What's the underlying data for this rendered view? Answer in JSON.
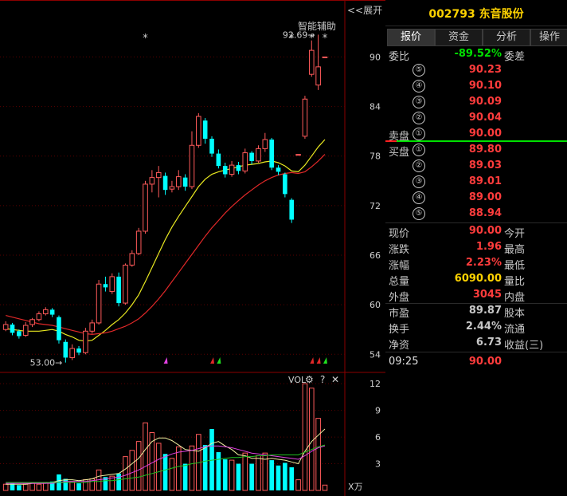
{
  "header": {
    "collapse_label": "<<展开",
    "aux_label": "智能辅助",
    "stock_title": "002793  东音股份"
  },
  "tabs": [
    {
      "label": "报价"
    },
    {
      "label": "资金"
    },
    {
      "label": "分析"
    },
    {
      "label": "操作"
    }
  ],
  "quote": {
    "weibi_label": "委比",
    "weibi_value": "-89.52%",
    "weicha_label": "委差",
    "sell_label": "卖盘",
    "buy_label": "买盘",
    "sell": [
      {
        "level": "⑤",
        "price": "90.23"
      },
      {
        "level": "④",
        "price": "90.10"
      },
      {
        "level": "③",
        "price": "90.09"
      },
      {
        "level": "②",
        "price": "90.04"
      },
      {
        "level": "①",
        "price": "90.00"
      }
    ],
    "buy": [
      {
        "level": "①",
        "price": "89.80"
      },
      {
        "level": "②",
        "price": "89.03"
      },
      {
        "level": "③",
        "price": "89.01"
      },
      {
        "level": "④",
        "price": "89.00"
      },
      {
        "level": "⑤",
        "price": "88.94"
      }
    ],
    "stats": [
      {
        "label": "现价",
        "value": "90.00",
        "label2": "今开",
        "color": "#ff3c3c"
      },
      {
        "label": "涨跌",
        "value": "1.96",
        "label2": "最高",
        "color": "#ff3c3c"
      },
      {
        "label": "涨幅",
        "value": "2.23%",
        "label2": "最低",
        "color": "#ff3c3c"
      },
      {
        "label": "总量",
        "value": "6090.00",
        "label2": "量比",
        "color": "#ffd300"
      },
      {
        "label": "外盘",
        "value": "3045",
        "label2": "内盘",
        "color": "#ff3c3c"
      },
      {
        "label": "市盈",
        "value": "89.87",
        "label2": "股本",
        "color": "#c8c8c8"
      },
      {
        "label": "换手",
        "value": "2.44%",
        "label2": "流通",
        "color": "#c8c8c8"
      },
      {
        "label": "净资",
        "value": "6.73",
        "label2": "收益(三)",
        "color": "#c8c8c8"
      }
    ],
    "tick_time": "09:25",
    "tick_price": "90.00"
  },
  "chart_data": {
    "type": "candlestick",
    "price_axis": {
      "ticks": [
        "90",
        "84",
        "78",
        "72",
        "66",
        "60",
        "54"
      ],
      "range": [
        52,
        94
      ]
    },
    "volume_axis": {
      "label": "VOL",
      "unit": "X万",
      "ticks": [
        "12",
        "9",
        "6",
        "3"
      ],
      "range": [
        0,
        13
      ]
    },
    "annotations": {
      "high": "92.69→",
      "low": "53.00→",
      "stars": [
        "*",
        "*",
        "*",
        "*"
      ]
    },
    "candles": [
      {
        "o": 57.0,
        "c": 57.6,
        "h": 58.0,
        "l": 56.8,
        "v": 0.7
      },
      {
        "o": 57.6,
        "c": 56.6,
        "h": 57.8,
        "l": 56.3,
        "v": 0.8
      },
      {
        "o": 56.8,
        "c": 56.2,
        "h": 57.0,
        "l": 55.9,
        "v": 0.6
      },
      {
        "o": 56.3,
        "c": 57.5,
        "h": 57.9,
        "l": 56.1,
        "v": 0.7
      },
      {
        "o": 57.6,
        "c": 58.2,
        "h": 58.4,
        "l": 57.3,
        "v": 0.8
      },
      {
        "o": 58.2,
        "c": 58.9,
        "h": 59.2,
        "l": 58.0,
        "v": 0.7
      },
      {
        "o": 58.9,
        "c": 59.4,
        "h": 59.7,
        "l": 58.7,
        "v": 0.9
      },
      {
        "o": 59.4,
        "c": 58.8,
        "h": 59.6,
        "l": 58.5,
        "v": 1.0
      },
      {
        "o": 58.5,
        "c": 55.7,
        "h": 58.7,
        "l": 55.3,
        "v": 1.8
      },
      {
        "o": 55.5,
        "c": 53.6,
        "h": 55.8,
        "l": 53.0,
        "v": 1.3
      },
      {
        "o": 53.6,
        "c": 54.7,
        "h": 55.2,
        "l": 53.3,
        "v": 1.0
      },
      {
        "o": 54.7,
        "c": 54.2,
        "h": 55.0,
        "l": 53.9,
        "v": 0.8
      },
      {
        "o": 54.2,
        "c": 56.8,
        "h": 57.2,
        "l": 54.0,
        "v": 1.2
      },
      {
        "o": 56.8,
        "c": 57.8,
        "h": 58.2,
        "l": 56.5,
        "v": 1.3
      },
      {
        "o": 57.8,
        "c": 62.5,
        "h": 63.0,
        "l": 57.6,
        "v": 2.3
      },
      {
        "o": 62.5,
        "c": 62.1,
        "h": 63.4,
        "l": 61.6,
        "v": 1.5
      },
      {
        "o": 61.6,
        "c": 63.4,
        "h": 63.8,
        "l": 61.3,
        "v": 1.6
      },
      {
        "o": 63.4,
        "c": 60.2,
        "h": 63.9,
        "l": 59.8,
        "v": 1.9
      },
      {
        "o": 60.2,
        "c": 64.8,
        "h": 65.0,
        "l": 60.0,
        "v": 3.8
      },
      {
        "o": 64.8,
        "c": 66.2,
        "h": 66.6,
        "l": 64.6,
        "v": 4.5
      },
      {
        "o": 66.2,
        "c": 68.9,
        "h": 69.3,
        "l": 66.0,
        "v": 5.5
      },
      {
        "o": 68.9,
        "c": 74.6,
        "h": 75.0,
        "l": 68.6,
        "v": 7.6
      },
      {
        "o": 74.6,
        "c": 75.4,
        "h": 76.3,
        "l": 73.6,
        "v": 6.5
      },
      {
        "o": 75.4,
        "c": 76.0,
        "h": 76.8,
        "l": 73.0,
        "v": 5.3
      },
      {
        "o": 75.6,
        "c": 73.9,
        "h": 76.0,
        "l": 73.3,
        "v": 4.1
      },
      {
        "o": 74.0,
        "c": 74.3,
        "h": 75.0,
        "l": 73.6,
        "v": 3.6
      },
      {
        "o": 74.3,
        "c": 75.5,
        "h": 76.3,
        "l": 73.9,
        "v": 4.9
      },
      {
        "o": 75.4,
        "c": 74.3,
        "h": 75.8,
        "l": 73.8,
        "v": 3.0
      },
      {
        "o": 74.3,
        "c": 79.3,
        "h": 81.0,
        "l": 74.0,
        "v": 5.0
      },
      {
        "o": 79.3,
        "c": 82.8,
        "h": 83.2,
        "l": 79.0,
        "v": 6.3
      },
      {
        "o": 82.3,
        "c": 80.1,
        "h": 82.6,
        "l": 79.5,
        "v": 5.1
      },
      {
        "o": 80.1,
        "c": 78.3,
        "h": 80.4,
        "l": 77.9,
        "v": 6.9
      },
      {
        "o": 78.3,
        "c": 76.8,
        "h": 78.8,
        "l": 76.5,
        "v": 4.3
      },
      {
        "o": 76.8,
        "c": 75.8,
        "h": 77.2,
        "l": 75.4,
        "v": 3.5
      },
      {
        "o": 75.8,
        "c": 76.9,
        "h": 77.4,
        "l": 75.5,
        "v": 3.4
      },
      {
        "o": 76.9,
        "c": 76.2,
        "h": 77.3,
        "l": 75.8,
        "v": 3.0
      },
      {
        "o": 76.2,
        "c": 78.4,
        "h": 78.9,
        "l": 75.9,
        "v": 4.2
      },
      {
        "o": 78.4,
        "c": 77.4,
        "h": 78.6,
        "l": 77.0,
        "v": 3.0
      },
      {
        "o": 77.4,
        "c": 78.9,
        "h": 79.3,
        "l": 77.2,
        "v": 3.9
      },
      {
        "o": 78.9,
        "c": 80.0,
        "h": 80.8,
        "l": 78.5,
        "v": 4.2
      },
      {
        "o": 80.0,
        "c": 76.6,
        "h": 80.2,
        "l": 76.3,
        "v": 3.4
      },
      {
        "o": 76.6,
        "c": 76.1,
        "h": 76.9,
        "l": 75.7,
        "v": 2.8
      },
      {
        "o": 75.8,
        "c": 73.4,
        "h": 76.0,
        "l": 73.0,
        "v": 3.1
      },
      {
        "o": 72.7,
        "c": 70.3,
        "h": 72.9,
        "l": 69.9,
        "v": 2.6
      },
      {
        "o": 78.2,
        "c": 78.2,
        "h": 78.2,
        "l": 78.2,
        "v": 1.2
      },
      {
        "o": 80.4,
        "c": 84.9,
        "h": 85.3,
        "l": 80.1,
        "v": 12.0
      },
      {
        "o": 87.9,
        "c": 90.8,
        "h": 92.0,
        "l": 87.6,
        "v": 11.5
      },
      {
        "o": 86.6,
        "c": 88.8,
        "h": 92.7,
        "l": 86.0,
        "v": 8.1
      },
      {
        "o": 90.0,
        "c": 90.0,
        "h": 90.0,
        "l": 90.0,
        "v": 0.6
      }
    ],
    "ma_lines": [
      {
        "color": "#e8e820",
        "values": [
          57.1,
          57.0,
          56.9,
          56.8,
          56.8,
          56.8,
          56.9,
          57.0,
          56.8,
          56.4,
          56.1,
          55.7,
          55.6,
          55.7,
          56.3,
          56.9,
          57.6,
          58.2,
          59.0,
          60.0,
          61.2,
          62.8,
          64.5,
          66.2,
          67.9,
          69.4,
          70.7,
          71.9,
          73.1,
          74.3,
          75.2,
          75.8,
          76.1,
          76.3,
          76.5,
          76.7,
          76.9,
          77.0,
          77.1,
          77.3,
          77.4,
          77.2,
          76.8,
          76.2,
          76.1,
          76.9,
          78.0,
          79.1,
          80.0
        ]
      },
      {
        "color": "#e02828",
        "values": [
          58.7,
          58.5,
          58.3,
          58.1,
          57.9,
          57.7,
          57.6,
          57.5,
          57.3,
          57.1,
          56.9,
          56.7,
          56.5,
          56.4,
          56.5,
          56.6,
          56.8,
          57.1,
          57.4,
          57.8,
          58.3,
          59.0,
          59.8,
          60.7,
          61.7,
          62.8,
          63.9,
          65.0,
          66.1,
          67.2,
          68.3,
          69.3,
          70.2,
          71.1,
          71.9,
          72.6,
          73.3,
          73.9,
          74.5,
          75.0,
          75.4,
          75.7,
          75.9,
          76.0,
          75.9,
          76.1,
          76.7,
          77.4,
          78.2
        ]
      }
    ],
    "volume_ma_lines": [
      {
        "color": "#f0f0a0",
        "values": [
          0.7,
          0.7,
          0.7,
          0.7,
          0.8,
          0.8,
          0.8,
          0.9,
          1.1,
          1.2,
          1.2,
          1.1,
          1.2,
          1.3,
          1.6,
          1.7,
          1.8,
          1.9,
          2.4,
          3.0,
          3.6,
          4.6,
          5.5,
          5.9,
          5.9,
          5.6,
          5.1,
          4.6,
          4.5,
          4.4,
          4.8,
          5.3,
          5.5,
          5.0,
          4.6,
          4.0,
          3.9,
          3.6,
          3.6,
          3.5,
          3.6,
          3.5,
          3.4,
          3.2,
          3.0,
          4.4,
          5.5,
          6.2,
          6.9
        ]
      },
      {
        "color": "#e040e0",
        "values": [
          0.8,
          0.8,
          0.8,
          0.8,
          0.8,
          0.8,
          0.8,
          0.8,
          0.9,
          1.0,
          1.0,
          1.0,
          1.0,
          1.1,
          1.2,
          1.3,
          1.4,
          1.5,
          1.7,
          2.0,
          2.3,
          2.7,
          3.1,
          3.5,
          3.8,
          4.1,
          4.3,
          4.4,
          4.5,
          4.7,
          4.9,
          5.0,
          5.0,
          4.9,
          4.8,
          4.6,
          4.4,
          4.2,
          4.1,
          4.0,
          3.9,
          3.8,
          3.7,
          3.6,
          3.5,
          3.9,
          4.4,
          4.8,
          5.0
        ]
      },
      {
        "color": "#20c020",
        "values": [
          0.9,
          0.9,
          0.9,
          0.9,
          0.9,
          0.9,
          0.9,
          0.9,
          0.9,
          0.9,
          0.9,
          0.9,
          0.9,
          1.0,
          1.0,
          1.1,
          1.1,
          1.2,
          1.3,
          1.4,
          1.5,
          1.7,
          1.9,
          2.1,
          2.3,
          2.5,
          2.7,
          2.8,
          3.0,
          3.1,
          3.3,
          3.4,
          3.5,
          3.6,
          3.7,
          3.7,
          3.8,
          3.8,
          3.9,
          3.9,
          4.0,
          4.0,
          4.0,
          4.0,
          4.0,
          4.3,
          4.6,
          4.9,
          5.1
        ]
      }
    ],
    "signals": [
      {
        "index": 24,
        "color": "#e040e0"
      },
      {
        "index": 31,
        "color": "#e02828"
      },
      {
        "index": 32,
        "color": "#20e020"
      },
      {
        "index": 46,
        "color": "#e02828"
      },
      {
        "index": 47,
        "color": "#e02828"
      },
      {
        "index": 48,
        "color": "#20e020"
      }
    ],
    "colors": {
      "up": "#ff5a5a",
      "down": "#00ffff",
      "grid": "#5a0000"
    }
  }
}
